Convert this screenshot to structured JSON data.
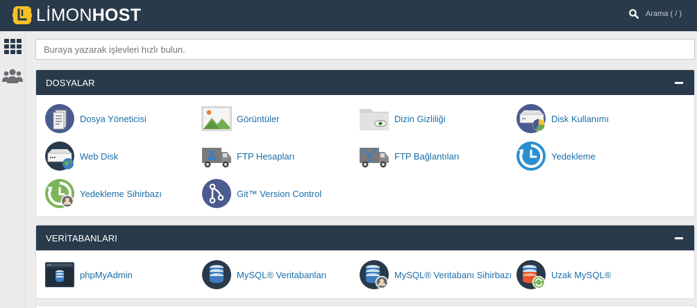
{
  "header": {
    "brand_part1": "LİMON",
    "brand_part2": "HOST",
    "search_label": "Arama ( / )"
  },
  "sidebar": {
    "items": [
      {
        "name": "tools",
        "icon": "grid-icon"
      },
      {
        "name": "users",
        "icon": "users-icon"
      }
    ]
  },
  "quick_search": {
    "placeholder": "Buraya yazarak işlevleri hızlı bulun."
  },
  "sections": [
    {
      "title": "DOSYALAR",
      "items": [
        {
          "label": "Dosya Yöneticisi",
          "icon": "file-manager-icon"
        },
        {
          "label": "Görüntüler",
          "icon": "images-icon"
        },
        {
          "label": "Dizin Gizliliği",
          "icon": "directory-privacy-icon"
        },
        {
          "label": "Disk Kullanımı",
          "icon": "disk-usage-icon"
        },
        {
          "label": "Web Disk",
          "icon": "web-disk-icon"
        },
        {
          "label": "FTP Hesapları",
          "icon": "ftp-accounts-icon"
        },
        {
          "label": "FTP Bağlantıları",
          "icon": "ftp-connections-icon"
        },
        {
          "label": "Yedekleme",
          "icon": "backup-icon"
        },
        {
          "label": "Yedekleme Sihirbazı",
          "icon": "backup-wizard-icon"
        },
        {
          "label": "Git™ Version Control",
          "icon": "git-icon"
        }
      ]
    },
    {
      "title": "VERİTABANLARI",
      "items": [
        {
          "label": "phpMyAdmin",
          "icon": "phpmyadmin-icon"
        },
        {
          "label": "MySQL® Veritabanları",
          "icon": "mysql-databases-icon"
        },
        {
          "label": "MySQL® Veritabanı Sihirbazı",
          "icon": "mysql-wizard-icon"
        },
        {
          "label": "Uzak MySQL®",
          "icon": "remote-mysql-icon"
        }
      ]
    }
  ],
  "colors": {
    "header_bg": "#293a4a",
    "link": "#1a6ea7",
    "brand_yellow": "#f6c124"
  }
}
